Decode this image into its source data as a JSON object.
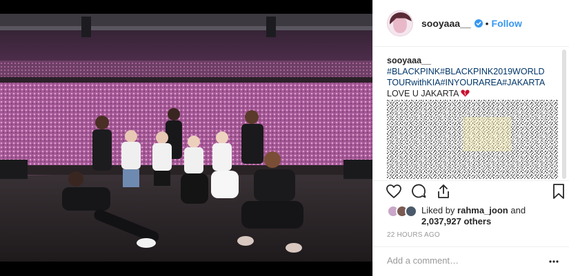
{
  "post": {
    "username": "sooyaaa__",
    "follow_label": "Follow",
    "separator": "•",
    "caption": {
      "username": "sooyaaa__",
      "hashtags": "#BLACKPINK#BLACKPINK2019WORLDTOURwithKIA#INYOURAREA#JAKARTA",
      "line": "LOVE U JAKARTA"
    },
    "likes": {
      "prefix": "Liked by",
      "liker": "rahma_joon",
      "connector": "and",
      "count_text": "2,037,927 others"
    },
    "timestamp": "22 HOURS AGO",
    "comment_placeholder": "Add a comment…"
  },
  "icons": {
    "verified": "verified-badge-icon",
    "like": "heart-outline-icon",
    "comment": "comment-bubble-icon",
    "share": "share-icon",
    "save": "bookmark-icon",
    "more": "more-options-icon",
    "caption_emoji": "broken-heart-emoji"
  },
  "colors": {
    "link": "#3897f0",
    "hashtag": "#003569",
    "text": "#262626",
    "muted": "#999999",
    "divider": "#efefef",
    "crowd_pink": "#c06aa8"
  }
}
